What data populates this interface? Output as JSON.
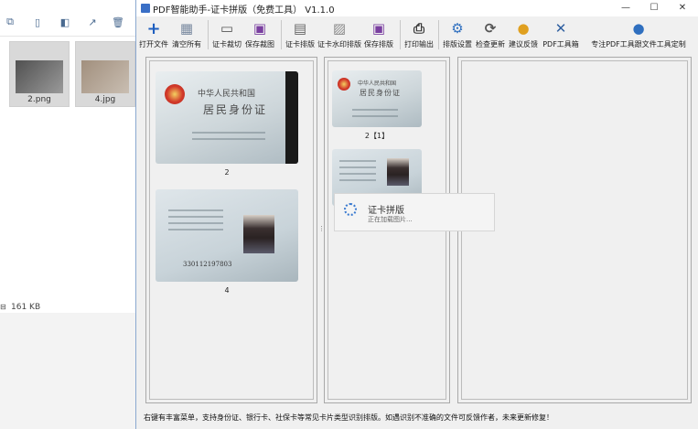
{
  "explorer": {
    "toolbar_icons": [
      "copy-icon",
      "paste-icon",
      "rename-icon",
      "share-icon",
      "delete-icon"
    ],
    "files": [
      {
        "name": "2.png"
      },
      {
        "name": "4.jpg"
      }
    ],
    "status": "161 KB"
  },
  "app": {
    "title": "PDF智能助手-证卡拼版（免费工具） V1.1.0",
    "window_controls": {
      "minimize": "—",
      "maximize": "☐",
      "close": "✕"
    },
    "toolbar": [
      {
        "label": "打开文件",
        "icon": "plus-icon",
        "symbol": "+",
        "color": "#1f5fbf"
      },
      {
        "label": "清空所有",
        "icon": "clear-all-icon",
        "symbol": "▦",
        "color": "#c0392b"
      },
      {
        "label": "证卡裁切",
        "icon": "crop-card-icon",
        "symbol": "▭",
        "color": "#555555"
      },
      {
        "label": "保存裁图",
        "icon": "save-crop-icon",
        "symbol": "▣",
        "color": "#7a3fa0"
      },
      {
        "label": "证卡排版",
        "icon": "layout-icon",
        "symbol": "▤",
        "color": "#666666"
      },
      {
        "label": "证卡水印排版",
        "icon": "watermark-icon",
        "symbol": "▨",
        "color": "#888888"
      },
      {
        "label": "保存排版",
        "icon": "save-layout-icon",
        "symbol": "▣",
        "color": "#7a3fa0"
      },
      {
        "label": "打印输出",
        "icon": "printer-icon",
        "symbol": "⎙",
        "color": "#333333"
      },
      {
        "label": "排版设置",
        "icon": "settings-icon",
        "symbol": "⚙",
        "color": "#2f6fbf"
      },
      {
        "label": "检查更新",
        "icon": "update-icon",
        "symbol": "⟳",
        "color": "#555555"
      },
      {
        "label": "建议反馈",
        "icon": "bulb-icon",
        "symbol": "●",
        "color": "#e0a020"
      },
      {
        "label": "PDF工具箱",
        "icon": "tools-icon",
        "symbol": "✕",
        "color": "#2f5fa0"
      },
      {
        "label": "专注PDF工具跟文件工具定制",
        "icon": "user-icon",
        "symbol": "●",
        "color": "#2f6fbf"
      }
    ],
    "panel1": {
      "cards": [
        {
          "caption": "2",
          "side": "front",
          "line1": "中华人民共和国",
          "line2": "居民身份证"
        },
        {
          "caption": "4",
          "side": "back",
          "number": "330112197803"
        }
      ]
    },
    "panel2": {
      "cards": [
        {
          "caption": "2【1】",
          "side": "front",
          "line1": "中华人民共和国",
          "line2": "居民身份证"
        },
        {
          "caption": "",
          "side": "back"
        }
      ]
    },
    "progress": {
      "title": "证卡拼版",
      "subtitle": "正在加载图片..."
    },
    "status": "右键有丰富菜单，支持身份证、银行卡、社保卡等常见卡片类型识别排版。如遇识别不准确的文件可反馈作者，未来更新修复！"
  }
}
